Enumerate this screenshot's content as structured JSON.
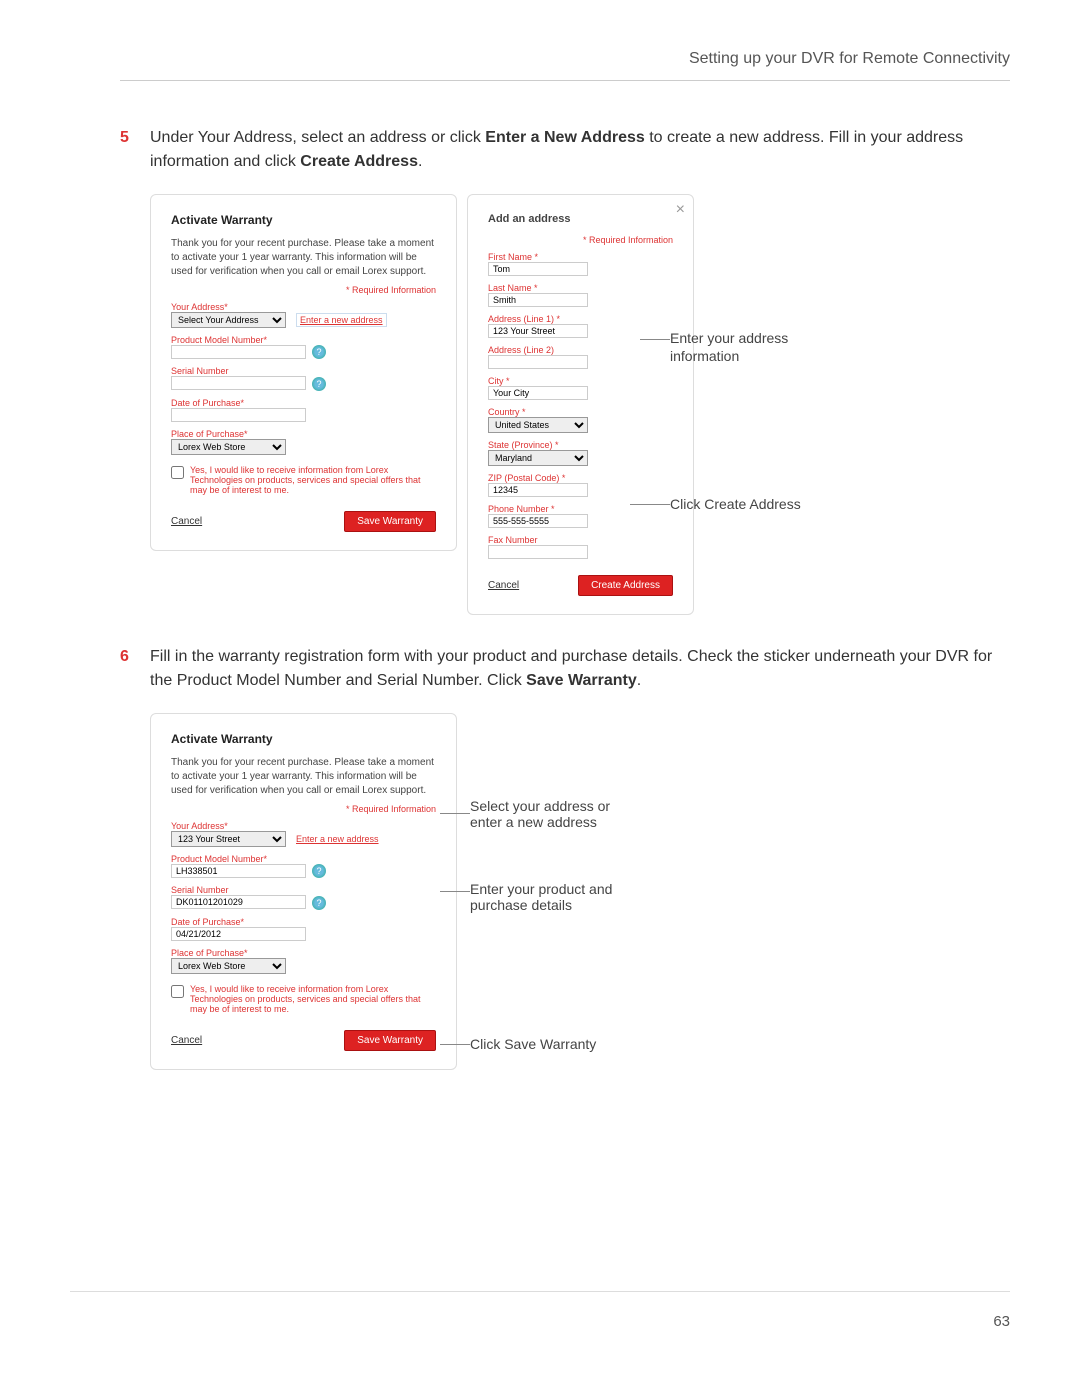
{
  "header": {
    "title": "Setting up your DVR for Remote Connectivity"
  },
  "page_number": "63",
  "steps": {
    "s5": {
      "num": "5",
      "text_a": "Under Your Address, select an address or click ",
      "bold_a": "Enter a New Address",
      "text_b": " to create a new address. Fill in your address information and click ",
      "bold_b": "Create Address",
      "text_c": "."
    },
    "s6": {
      "num": "6",
      "text_a": "Fill in the warranty registration form with your product and purchase details. Check the sticker underneath your DVR for the Product Model Number and Serial Number. Click ",
      "bold_a": "Save Warranty",
      "text_b": "."
    }
  },
  "warranty1": {
    "title": "Activate Warranty",
    "intro": "Thank you for your recent purchase. Please take a moment to activate your 1 year warranty. This information will be used for verification when you call or email Lorex support.",
    "req": "* Required Information",
    "addr_label": "Your Address*",
    "addr_select": "Select Your Address",
    "enter_new": "Enter a new address",
    "model_label": "Product Model Number*",
    "serial_label": "Serial Number",
    "dop_label": "Date of Purchase*",
    "pop_label": "Place of Purchase*",
    "pop_value": "Lorex Web Store",
    "opt_in": "Yes, I would like to receive information from Lorex Technologies on products, services and special offers that may be of interest to me.",
    "save": "Save Warranty",
    "cancel": "Cancel"
  },
  "addaddr": {
    "title": "Add an address",
    "req": "* Required Information",
    "fn_label": "First Name *",
    "fn_value": "Tom",
    "ln_label": "Last Name *",
    "ln_value": "Smith",
    "a1_label": "Address (Line 1) *",
    "a1_value": "123 Your Street",
    "a2_label": "Address (Line 2)",
    "city_label": "City *",
    "city_value": "Your City",
    "country_label": "Country *",
    "country_value": "United States",
    "state_label": "State (Province) *",
    "state_value": "Maryland",
    "zip_label": "ZIP (Postal Code) *",
    "zip_value": "12345",
    "phone_label": "Phone Number *",
    "phone_value": "555-555-5555",
    "fax_label": "Fax Number",
    "create": "Create Address",
    "cancel": "Cancel"
  },
  "warranty2": {
    "title": "Activate Warranty",
    "intro": "Thank you for your recent purchase. Please take a moment to activate your 1 year warranty. This information will be used for verification when you call or email Lorex support.",
    "req": "* Required Information",
    "addr_label": "Your Address*",
    "addr_value": "123 Your Street",
    "enter_new": "Enter a new address",
    "model_label": "Product Model Number*",
    "model_value": "LH338501",
    "serial_label": "Serial Number",
    "serial_value": "DK01101201029",
    "dop_label": "Date of Purchase*",
    "dop_value": "04/21/2012",
    "pop_label": "Place of Purchase*",
    "pop_value": "Lorex Web Store",
    "opt_in": "Yes, I would like to receive information from Lorex Technologies on products, services and special offers that may be of interest to me.",
    "save": "Save Warranty",
    "cancel": "Cancel"
  },
  "annots": {
    "a1": "Enter your address information",
    "a2": "Click Create Address",
    "a3a": "Select your address or",
    "a3b": "enter a new address",
    "a4a": "Enter your product and",
    "a4b": "purchase details",
    "a5": "Click Save Warranty"
  }
}
